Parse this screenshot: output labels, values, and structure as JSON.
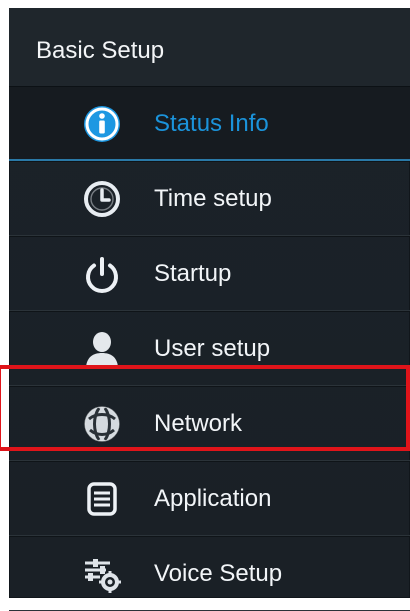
{
  "section": {
    "title": "Basic Setup"
  },
  "menu": {
    "items": [
      {
        "label": "Status Info",
        "icon": "info-icon",
        "active": true
      },
      {
        "label": "Time setup",
        "icon": "clock-icon",
        "active": false
      },
      {
        "label": "Startup",
        "icon": "power-icon",
        "active": false
      },
      {
        "label": "User setup",
        "icon": "user-icon",
        "active": false
      },
      {
        "label": "Network",
        "icon": "network-icon",
        "active": false
      },
      {
        "label": "Application",
        "icon": "application-icon",
        "active": false
      },
      {
        "label": "Voice Setup",
        "icon": "voice-setup-icon",
        "active": false
      }
    ]
  },
  "colors": {
    "panel_bg": "#1b2229",
    "text": "#f2f5f8",
    "accent": "#1b93da",
    "highlight": "#e0141a"
  }
}
